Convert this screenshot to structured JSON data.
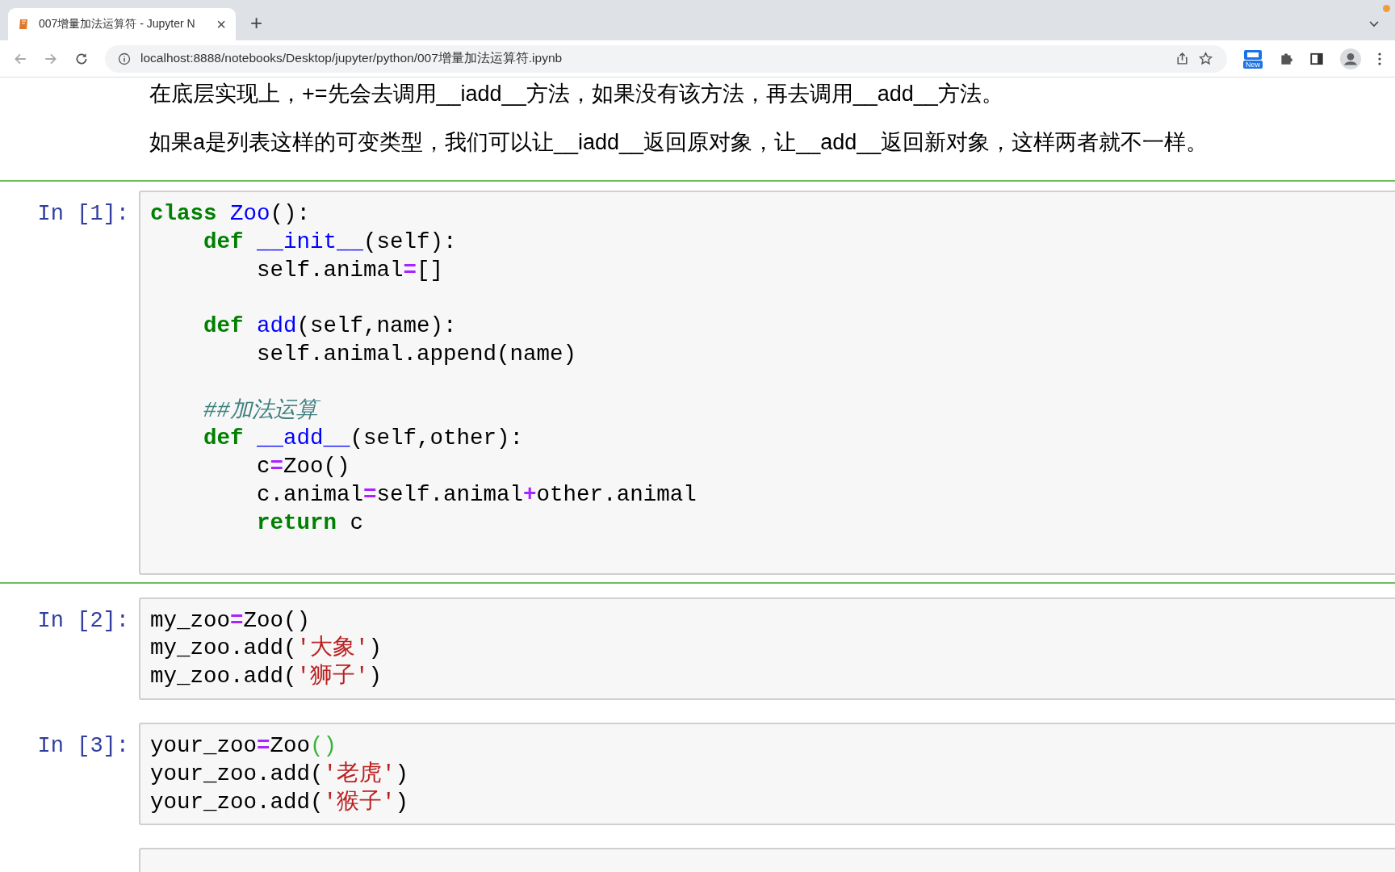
{
  "browser": {
    "tab": {
      "title": "007增量加法运算符 - Jupyter N",
      "close": "×",
      "selected": true
    },
    "new_tab": "+",
    "url": "localhost:8888/notebooks/Desktop/jupyter/python/007增量加法运算符.ipynb",
    "extension_badge": "New"
  },
  "markdown": [
    "在底层实现上，+=先会去调用__iadd__方法，如果没有该方法，再去调用__add__方法。",
    "如果a是列表这样的可变类型，我们可以让__iadd__返回原对象，让__add__返回新对象，这样两者就不一样。"
  ],
  "cells": [
    {
      "prompt": "In [1]:",
      "selected": true,
      "lines": [
        {
          "tokens": [
            {
              "text": "class",
              "kind": "keyword"
            },
            {
              "text": " Zoo",
              "kind": "name"
            },
            {
              "text": "():",
              "kind": "plain"
            }
          ]
        },
        {
          "tokens": [
            {
              "text": "    def",
              "kind": "keyword"
            },
            {
              "text": " __init__",
              "kind": "name"
            },
            {
              "text": "(self):",
              "kind": "plain"
            }
          ]
        },
        {
          "tokens": [
            {
              "text": "        self.animal",
              "kind": "plain"
            },
            {
              "text": "=",
              "kind": "operator"
            },
            {
              "text": "[]",
              "kind": "plain"
            }
          ]
        },
        {
          "gap_before": true,
          "tokens": [
            {
              "text": "    def",
              "kind": "keyword"
            },
            {
              "text": " add",
              "kind": "name"
            },
            {
              "text": "(self,name):",
              "kind": "plain"
            }
          ]
        },
        {
          "tokens": [
            {
              "text": "        self.animal.append(name)",
              "kind": "plain"
            }
          ]
        },
        {
          "gap_before": true,
          "tokens": [
            {
              "text": "    ##加法运算",
              "kind": "comment"
            }
          ]
        },
        {
          "tokens": [
            {
              "text": "    def",
              "kind": "keyword"
            },
            {
              "text": " __add__",
              "kind": "name"
            },
            {
              "text": "(self,other):",
              "kind": "plain"
            }
          ]
        },
        {
          "tokens": [
            {
              "text": "        c",
              "kind": "plain"
            },
            {
              "text": "=",
              "kind": "operator"
            },
            {
              "text": "Zoo()",
              "kind": "plain"
            }
          ]
        },
        {
          "tokens": [
            {
              "text": "        c.animal",
              "kind": "plain"
            },
            {
              "text": "=",
              "kind": "operator"
            },
            {
              "text": "self.animal",
              "kind": "plain"
            },
            {
              "text": "+",
              "kind": "operator"
            },
            {
              "text": "other.animal",
              "kind": "plain"
            }
          ]
        },
        {
          "tokens": [
            {
              "text": "        return",
              "kind": "keyword"
            },
            {
              "text": " c",
              "kind": "plain"
            }
          ]
        }
      ]
    },
    {
      "prompt": "In [2]:",
      "selected": false,
      "lines": [
        {
          "tokens": [
            {
              "text": "my_zoo",
              "kind": "plain"
            },
            {
              "text": "=",
              "kind": "operator"
            },
            {
              "text": "Zoo()",
              "kind": "plain"
            }
          ]
        },
        {
          "tokens": [
            {
              "text": "my_zoo.add(",
              "kind": "plain"
            },
            {
              "text": "'大象'",
              "kind": "string"
            },
            {
              "text": ")",
              "kind": "plain"
            }
          ]
        },
        {
          "tokens": [
            {
              "text": "my_zoo.add(",
              "kind": "plain"
            },
            {
              "text": "'狮子'",
              "kind": "string"
            },
            {
              "text": ")",
              "kind": "plain"
            }
          ]
        }
      ]
    },
    {
      "prompt": "In [3]:",
      "selected": false,
      "lines": [
        {
          "tokens": [
            {
              "text": "your_zoo",
              "kind": "plain"
            },
            {
              "text": "=",
              "kind": "operator"
            },
            {
              "text": "Zoo",
              "kind": "plain"
            },
            {
              "text": "()",
              "kind": "bracket_match"
            }
          ]
        },
        {
          "tokens": [
            {
              "text": "your_zoo.add(",
              "kind": "plain"
            },
            {
              "text": "'老虎'",
              "kind": "string"
            },
            {
              "text": ")",
              "kind": "plain"
            }
          ]
        },
        {
          "tokens": [
            {
              "text": "your_zoo.add(",
              "kind": "plain"
            },
            {
              "text": "'猴子'",
              "kind": "string"
            },
            {
              "text": ")",
              "kind": "plain"
            }
          ]
        }
      ]
    },
    {
      "selected": false
    }
  ]
}
